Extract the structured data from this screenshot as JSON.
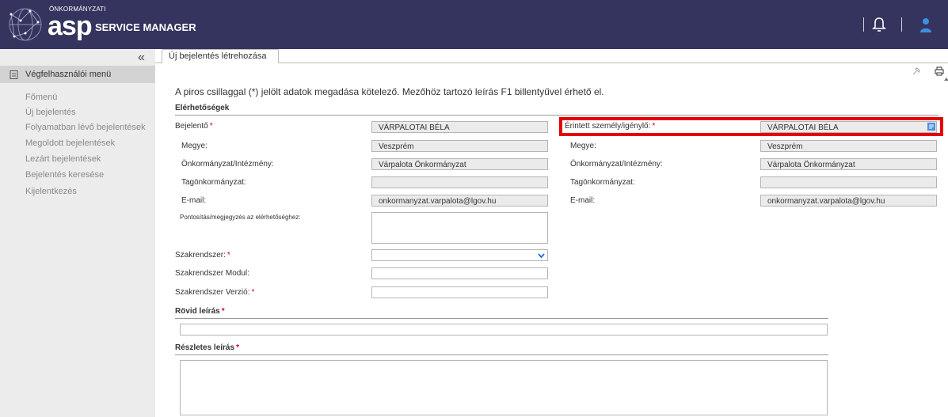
{
  "header": {
    "brand_small": "ÖNKORMÁNYZATI",
    "brand_asp": "asp",
    "brand_product": "SERVICE MANAGER"
  },
  "sidebar": {
    "collapse_label": "«",
    "menu_title": "Végfelhasználói menü",
    "items": [
      {
        "label": "Főmenü"
      },
      {
        "label": "Új bejelentés"
      },
      {
        "label": "Folyamatban lévő bejelentések"
      },
      {
        "label": "Megoldott bejelentések"
      },
      {
        "label": "Lezárt bejelentések"
      },
      {
        "label": "Bejelentés keresése"
      },
      {
        "label": "Kijelentkezés"
      }
    ]
  },
  "tabs": [
    {
      "label": "Új bejelentés létrehozása"
    }
  ],
  "form": {
    "intro": "A piros csillaggal (*) jelölt adatok megadása kötelező. Mezőhöz tartozó leírás F1 billentyűvel érhető el.",
    "contacts_title": "Elérhetőségek",
    "reporter": {
      "label": "Bejelentő",
      "value": "VÁRPALOTAI BÉLA",
      "megye_label": "Megye:",
      "megye_value": "Veszprém",
      "onk_label": "Önkormányzat/Intézmény:",
      "onk_value": "Várpalota Önkormányzat",
      "tag_label": "Tagönkormányzat:",
      "tag_value": "",
      "email_label": "E-mail:",
      "email_value": "onkormanyzat.varpalota@lgov.hu"
    },
    "affected": {
      "label": "Érintett személy/igénylő:",
      "value": "VÁRPALOTAI BÉLA",
      "megye_label": "Megye:",
      "megye_value": "Veszprém",
      "onk_label": "Önkormányzat/Intézmény:",
      "onk_value": "Várpalota Önkormányzat",
      "tag_label": "Tagönkormányzat:",
      "tag_value": "",
      "email_label": "E-mail:",
      "email_value": "onkormanyzat.varpalota@lgov.hu"
    },
    "note_label": "Pontosítás/megjegyzés az elérhetőséghez:",
    "note_value": "",
    "system_label": "Szakrendszer:",
    "system_value": "",
    "module_label": "Szakrendszer Modul:",
    "module_value": "",
    "version_label": "Szakrendszer Verzió:",
    "version_value": "",
    "short_desc_title": "Rövid leírás",
    "short_desc_value": "",
    "long_desc_title": "Részletes leírás",
    "long_desc_value": "",
    "required_mark": "*"
  },
  "colors": {
    "header_bg": "#35345e",
    "sidebar_bg": "#ececec",
    "highlight": "#e60000",
    "required": "#d0021b"
  }
}
